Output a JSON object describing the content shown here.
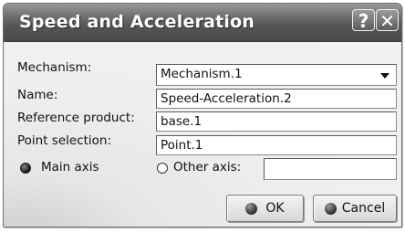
{
  "window": {
    "title": "Speed and Acceleration",
    "help_glyph": "?",
    "close_glyph": "✕"
  },
  "form": {
    "mechanism": {
      "label": "Mechanism:",
      "value": "Mechanism.1"
    },
    "name": {
      "label": "Name:",
      "value": "Speed-Acceleration.2"
    },
    "reference_product": {
      "label": "Reference product:",
      "value": "base.1"
    },
    "point_selection": {
      "label": "Point selection:",
      "value": "Point.1"
    },
    "axis": {
      "main_label": "Main axis",
      "other_label": "Other axis:",
      "selected": "main",
      "other_value": ""
    }
  },
  "buttons": {
    "ok_label": "OK",
    "cancel_label": "Cancel"
  },
  "icons": {
    "help": "help-icon",
    "close": "close-icon",
    "combo": "chevron-down-icon",
    "ok": "ok-icon",
    "cancel": "cancel-icon"
  }
}
